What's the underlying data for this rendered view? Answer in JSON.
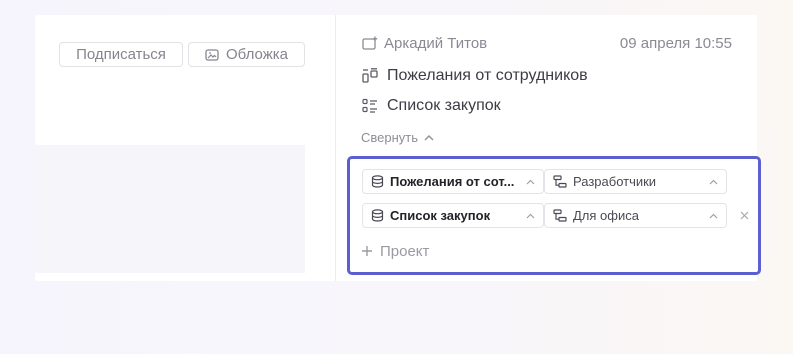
{
  "left_panel": {
    "subscribe_label": "Подписаться",
    "cover_label": "Обложка"
  },
  "meta": {
    "author": "Аркадий Титов",
    "date": "09 апреля 10:55"
  },
  "lists": [
    {
      "label": "Пожелания от сотрудников",
      "icon": "form-fields-icon"
    },
    {
      "label": "Список закупок",
      "icon": "checklist-icon"
    }
  ],
  "collapse_label": "Свернуть",
  "rows": [
    {
      "project": "Пожелания от сот...",
      "department": "Разработчики"
    },
    {
      "project": "Список закупок",
      "department": "Для офиса"
    }
  ],
  "add_project_label": "Проект",
  "colors": {
    "accent": "#5b5fd0",
    "muted_text": "#8a8a94",
    "border": "#e3e3e8"
  }
}
